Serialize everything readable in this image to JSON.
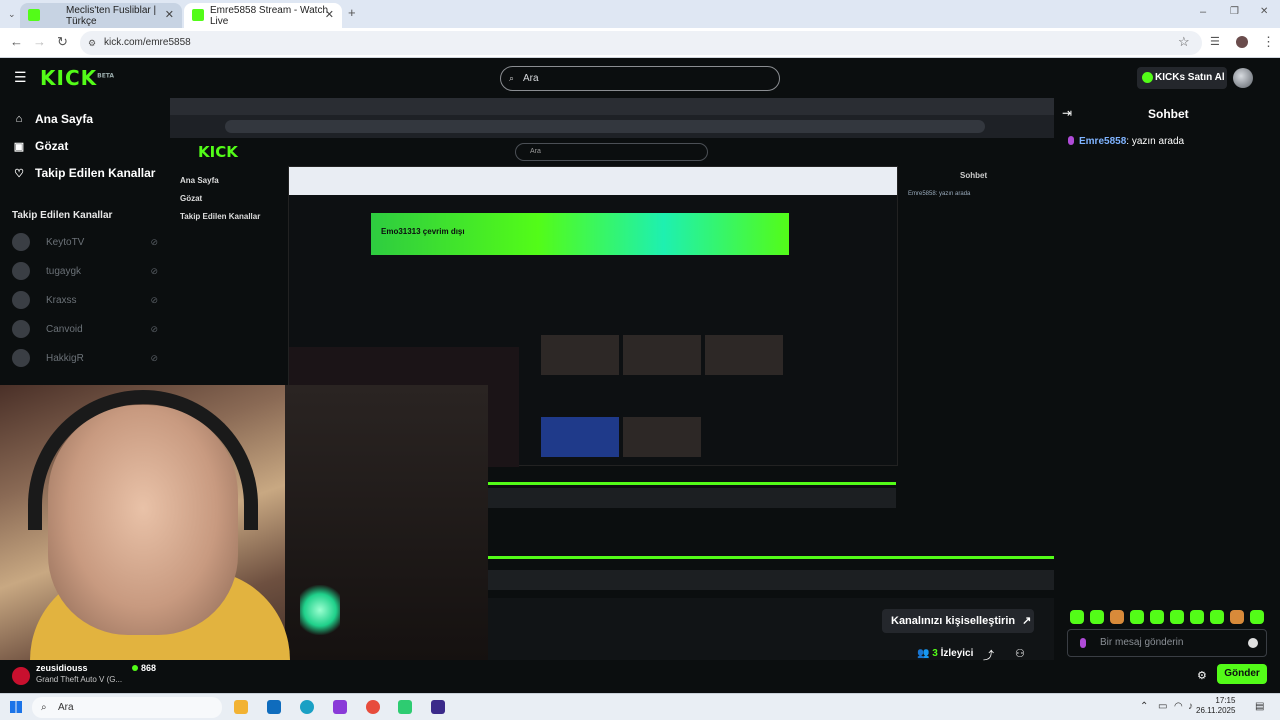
{
  "browser": {
    "tabs": [
      {
        "title": "Meclis'ten Fusliblar | Türkçe",
        "active": false
      },
      {
        "title": "Emre5858 Stream - Watch Live",
        "active": true
      }
    ],
    "new_tab_label": "+",
    "url": "kick.com/emre5858"
  },
  "header": {
    "logo_text": "KICK",
    "logo_sup": "BETA",
    "search_placeholder": "Ara",
    "buy_kicks_label": "KICKs Satın Al"
  },
  "sidebar": {
    "nav": [
      {
        "label": "Ana Sayfa",
        "icon": "home-icon"
      },
      {
        "label": "Gözat",
        "icon": "browse-icon"
      },
      {
        "label": "Takip Edilen Kanallar",
        "icon": "heart-icon"
      }
    ],
    "followed_title": "Takip Edilen Kanallar",
    "channels": [
      {
        "name": "KeytoTV"
      },
      {
        "name": "tugaygk"
      },
      {
        "name": "Kraxss"
      },
      {
        "name": "Canvoid"
      },
      {
        "name": "HakkigR"
      }
    ]
  },
  "stream": {
    "nested_search": "Ara",
    "nested_chat_title": "Sohbet",
    "nested_chat_msg": "Emre5858: yazın arada",
    "nested_banner_text": "Emo31313 çevrim dışı",
    "nested_nav": [
      "Ana Sayfa",
      "Gözat",
      "Takip Edilen Kanallar"
    ],
    "personalize_label": "Kanalınızı kişiselleştirin",
    "viewer_count": "3",
    "viewer_label": "İzleyici"
  },
  "chat": {
    "title": "Sohbet",
    "messages": [
      {
        "user": "Emre5858",
        "text": ": yazın arada"
      }
    ],
    "input_placeholder": "Bir mesaj gönderin",
    "send_label": "Gönder"
  },
  "streamer": {
    "name": "zeusidiouss",
    "game": "Grand Theft Auto V (G...",
    "viewers": "868"
  },
  "taskbar": {
    "search_label": "Ara",
    "time": "17:15",
    "date": "26.11.2025"
  },
  "colors": {
    "brand": "#53fc18",
    "background": "#0b0e0f",
    "mic": "#b04bd8"
  }
}
